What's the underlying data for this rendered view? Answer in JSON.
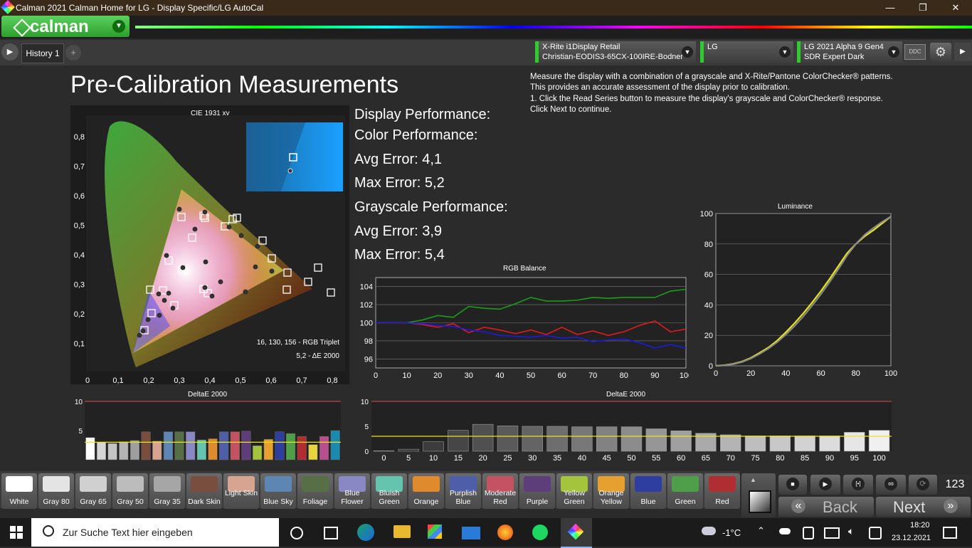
{
  "window": {
    "title": "Calman 2021 Calman Home for LG  - Display Specific/LG AutoCal",
    "minimize": "—",
    "maximize": "❐",
    "close": "✕"
  },
  "brand": {
    "logo_text": "calman",
    "menu_arrow": "▼"
  },
  "tabs": {
    "history_label": "History 1",
    "add_tab": "+",
    "play_icon": "▶"
  },
  "devices": {
    "meter": {
      "line1": "X-Rite i1Display Retail",
      "line2": "Christian-EODIS3-65CX-100IRE-Bodner"
    },
    "source": {
      "line1": "LG",
      "line2": ""
    },
    "display": {
      "line1": "LG 2021 Alpha 9 Gen4",
      "line2": "SDR Expert Dark"
    },
    "ddc_label": "DDC",
    "settings_icon": "⚙",
    "nav_right": "▶"
  },
  "page": {
    "title": "Pre-Calibration Measurements",
    "instructions": [
      "Measure the display with a combination of a grayscale and X-Rite/Pantone ColorChecker® patterns.",
      "This provides an accurate assessment of the display prior to calibration.",
      "1. Click the Read Series button to measure the display's grayscale and ColorChecker® response.",
      "Click Next to continue."
    ]
  },
  "performance": {
    "display_label": "Display Performance:",
    "color_label": "Color Performance:",
    "color_avg": "Avg Error: 4,1",
    "color_max": "Max Error: 5,2",
    "grayscale_label": "Grayscale Performance:",
    "gray_avg": "Avg Error: 3,9",
    "gray_max": "Max Error: 5,4"
  },
  "cie": {
    "title": "CIE 1931 xy",
    "rgb_triplet": "16, 130, 156 - RGB Triplet",
    "delta": "5,2 - ΔE 2000",
    "xticks": [
      "0",
      "0,1",
      "0,2",
      "0,3",
      "0,4",
      "0,5",
      "0,6",
      "0,7",
      "0,8"
    ],
    "yticks": [
      "0,1",
      "0,2",
      "0,3",
      "0,4",
      "0,5",
      "0,6",
      "0,7",
      "0,8"
    ]
  },
  "chart_data": [
    {
      "type": "line",
      "title": "RGB Balance",
      "x": [
        0,
        5,
        10,
        15,
        20,
        25,
        30,
        35,
        40,
        45,
        50,
        55,
        60,
        65,
        70,
        75,
        80,
        85,
        90,
        95,
        100
      ],
      "xticks": [
        "0",
        "10",
        "20",
        "30",
        "40",
        "50",
        "60",
        "70",
        "80",
        "90",
        "100"
      ],
      "yticks": [
        "96",
        "98",
        "100",
        "102",
        "104"
      ],
      "ylim": [
        95,
        105
      ],
      "series": [
        {
          "color": "#1a9e1a",
          "values": [
            100,
            100,
            100,
            100.3,
            100.8,
            100.6,
            101.8,
            101.6,
            101.5,
            102.1,
            102.8,
            102.4,
            102.4,
            102.5,
            102.8,
            102.7,
            102.8,
            102.8,
            102.8,
            103.5,
            103.7
          ]
        },
        {
          "color": "#e31a1a",
          "values": [
            100,
            100,
            100,
            99.8,
            99.5,
            99.9,
            98.9,
            99.5,
            99.2,
            98.8,
            99.2,
            98.7,
            99.5,
            98.7,
            99.1,
            98.6,
            99.0,
            99.7,
            100.2,
            99.0,
            99.3
          ]
        },
        {
          "color": "#1a1ae3",
          "values": [
            100,
            100,
            100,
            99.9,
            99.7,
            99.6,
            99.2,
            99.0,
            98.6,
            98.5,
            98.4,
            98.6,
            98.3,
            98.4,
            97.9,
            98.1,
            98.2,
            97.8,
            97.2,
            97.6,
            97.2
          ]
        }
      ]
    },
    {
      "type": "line",
      "title": "Luminance",
      "x": [
        0,
        5,
        10,
        15,
        20,
        25,
        30,
        35,
        40,
        45,
        50,
        55,
        60,
        65,
        70,
        75,
        80,
        85,
        90,
        95,
        100
      ],
      "xticks": [
        "0",
        "20",
        "40",
        "60",
        "80",
        "100"
      ],
      "yticks": [
        "0",
        "20",
        "40",
        "60",
        "80",
        "100"
      ],
      "ylim": [
        0,
        100
      ],
      "series": [
        {
          "color": "#e8e81a",
          "values": [
            0,
            0.4,
            1.3,
            2.8,
            5.2,
            8.5,
            12,
            16.5,
            22,
            28,
            34.5,
            41.5,
            49,
            57,
            65.5,
            74,
            80,
            85,
            89,
            93.5,
            98
          ]
        },
        {
          "color": "#8a8a8a",
          "values": [
            0,
            0.3,
            1.1,
            2.5,
            4.8,
            7.8,
            11.3,
            15.5,
            20.5,
            26.2,
            32.5,
            39.5,
            47,
            55,
            63.5,
            72.5,
            80,
            86,
            90.5,
            94.5,
            98
          ]
        }
      ]
    },
    {
      "type": "bar",
      "title": "DeltaE 2000",
      "ylim": [
        0,
        10
      ],
      "yticks": [
        "5",
        "10"
      ],
      "threshold": 3,
      "colors": [
        "#ffffff",
        "#d6d6d6",
        "#c4c4c4",
        "#b4b4b4",
        "#9e9e9e",
        "#7a4e3e",
        "#d6a490",
        "#5e86b4",
        "#586e44",
        "#8a88c4",
        "#64c4ae",
        "#e08a2e",
        "#4e5ea8",
        "#c45262",
        "#5e3e7a",
        "#a4c43e",
        "#e6a030",
        "#2e3ea0",
        "#4e9e4a",
        "#b02e32",
        "#e8d43e",
        "#b84e8e",
        "#1a8aae"
      ],
      "values": [
        3.8,
        3.0,
        2.8,
        3.1,
        3.3,
        4.8,
        3.2,
        4.8,
        4.8,
        4.8,
        3.4,
        3.6,
        4.8,
        4.8,
        4.9,
        2.4,
        3.5,
        4.8,
        4.5,
        4.0,
        2.6,
        4.0,
        5.0
      ]
    },
    {
      "type": "bar",
      "title": "DeltaE 2000",
      "categories": [
        "0",
        "5",
        "10",
        "15",
        "20",
        "25",
        "30",
        "35",
        "40",
        "45",
        "50",
        "55",
        "60",
        "65",
        "70",
        "75",
        "80",
        "85",
        "90",
        "95",
        "100"
      ],
      "ylim": [
        0,
        10
      ],
      "yticks": [
        "0",
        "5",
        "10"
      ],
      "threshold": 3,
      "values": [
        0.1,
        0.4,
        1.9,
        4.2,
        5.4,
        5.1,
        5.0,
        5.0,
        4.9,
        4.9,
        4.9,
        4.5,
        4.1,
        3.6,
        3.3,
        3.1,
        3.1,
        3.1,
        3.1,
        3.8,
        4.2
      ]
    }
  ],
  "swatches": [
    {
      "label": "White",
      "color": "#ffffff"
    },
    {
      "label": "Gray 80",
      "color": "#e4e4e4"
    },
    {
      "label": "Gray 65",
      "color": "#d0d0d0"
    },
    {
      "label": "Gray 50",
      "color": "#bcbcbc"
    },
    {
      "label": "Gray 35",
      "color": "#a6a6a6"
    },
    {
      "label": "Dark Skin",
      "color": "#7a4e3e"
    },
    {
      "label": "Light Skin",
      "color": "#d6a490"
    },
    {
      "label": "Blue Sky",
      "color": "#5e86b4"
    },
    {
      "label": "Foliage",
      "color": "#586e44"
    },
    {
      "label": "Blue Flower",
      "color": "#8a88c4"
    },
    {
      "label": "Bluish Green",
      "color": "#64c4ae"
    },
    {
      "label": "Orange",
      "color": "#e08a2e"
    },
    {
      "label": "Purplish Blue",
      "color": "#4e5ea8"
    },
    {
      "label": "Moderate Red",
      "color": "#c45262"
    },
    {
      "label": "Purple",
      "color": "#5e3e7a"
    },
    {
      "label": "Yellow Green",
      "color": "#a4c43e"
    },
    {
      "label": "Orange Yellow",
      "color": "#e6a030"
    },
    {
      "label": "Blue",
      "color": "#2e3ea0"
    },
    {
      "label": "Green",
      "color": "#4e9e4a"
    },
    {
      "label": "Red",
      "color": "#b02e32"
    }
  ],
  "transport": {
    "stop": "■",
    "play": "▶",
    "frame": "[•]",
    "loop": "∞",
    "refresh": "⟳",
    "counter": "123",
    "back_label": "Back",
    "next_label": "Next",
    "back_icon": "«",
    "next_icon": "»"
  },
  "taskbar": {
    "search_placeholder": "Zur Suche Text hier eingeben",
    "weather": "-1°C",
    "time": "18:20",
    "date": "23.12.2021"
  }
}
